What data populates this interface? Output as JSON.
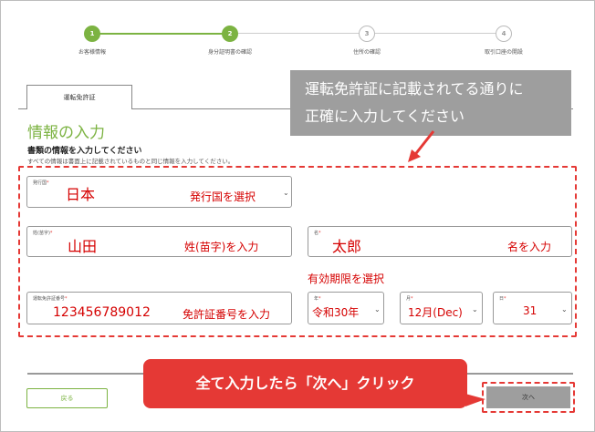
{
  "stepper": {
    "steps": [
      {
        "number": "1",
        "label": "お客様情報"
      },
      {
        "number": "2",
        "label": "身分証明書の確認"
      },
      {
        "number": "3",
        "label": "住所の確認"
      },
      {
        "number": "4",
        "label": "取引口座の開設"
      }
    ],
    "done_color": "#7cb342"
  },
  "tab": {
    "label": "運転免許証"
  },
  "section_title": "情報の入力",
  "form": {
    "heading": "書類の情報を入力してください",
    "subtext": "すべての情報は書面上に記載されているものと同じ情報を入力してください。",
    "issuing_country": {
      "label": "発行国",
      "value": "日本",
      "hint": "発行国を選択"
    },
    "last_name": {
      "label": "姓(苗字)",
      "value": "山田",
      "hint": "姓(苗字)を入力"
    },
    "first_name": {
      "label": "名",
      "value": "太郎",
      "hint": "名を入力"
    },
    "expiry_note": "有効期限を選択",
    "license_number": {
      "label": "運転免許証番号",
      "value": "123456789012",
      "hint": "免許証番号を入力"
    },
    "year": {
      "label": "年",
      "value": "令和30年"
    },
    "month": {
      "label": "月",
      "value": "12月(Dec)"
    },
    "day": {
      "label": "日",
      "value": "31"
    }
  },
  "callout_top": {
    "line1": "運転免許証に記載されてる通りに",
    "line2": "正確に入力してください"
  },
  "callout_bottom": "全て入力したら「次へ」クリック",
  "buttons": {
    "back": "戻る",
    "next": "次へ"
  },
  "icons": {
    "chevron": "chevron-down-icon",
    "arrow": "pointer-arrow-icon"
  },
  "colors": {
    "accent_green": "#7cb342",
    "annotation_red": "#e53935",
    "callout_gray": "#9e9e9e"
  }
}
